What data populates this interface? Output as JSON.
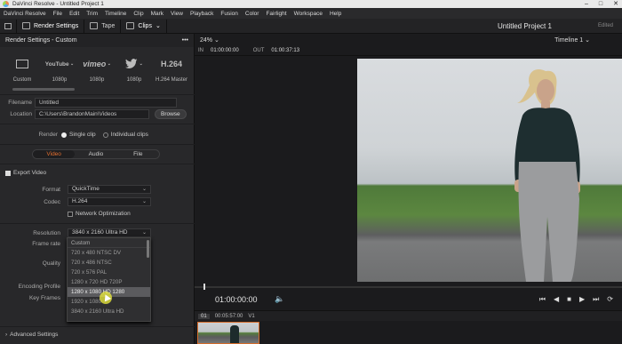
{
  "titlebar": {
    "title": "DaVinci Resolve - Untitled Project 1",
    "controls": [
      "–",
      "□",
      "✕"
    ]
  },
  "menu": [
    "DaVinci Resolve",
    "File",
    "Edit",
    "Trim",
    "Timeline",
    "Clip",
    "Mark",
    "View",
    "Playback",
    "Fusion",
    "Color",
    "Fairlight",
    "Workspace",
    "Help"
  ],
  "toolbar": {
    "render_settings": "Render Settings",
    "tape": "Tape",
    "clips": "Clips",
    "project_title": "Untitled Project 1",
    "status": "Edited"
  },
  "panel": {
    "header": "Render Settings - Custom",
    "menu_dots": "•••",
    "presets": [
      {
        "icon": "▭",
        "label": "Custom"
      },
      {
        "icon": "YouTube",
        "label": "1080p"
      },
      {
        "icon": "vimeo",
        "label": "1080p"
      },
      {
        "icon": "🐦",
        "label": "1080p"
      },
      {
        "icon": "H.264",
        "label": "H.264 Master"
      }
    ],
    "filename_label": "Filename",
    "filename_value": "Untitled",
    "location_label": "Location",
    "location_value": "C:\\Users\\BrandonMain\\Videos",
    "browse": "Browse",
    "render_label": "Render",
    "render_single": "Single clip",
    "render_individual": "Individual clips",
    "tabs": [
      "Video",
      "Audio",
      "File"
    ],
    "export_video": "Export Video",
    "format_label": "Format",
    "format_value": "QuickTime",
    "codec_label": "Codec",
    "codec_value": "H.264",
    "network_opt": "Network Optimization",
    "resolution_label": "Resolution",
    "resolution_value": "3840 x 2160 Ultra HD",
    "framerate_label": "Frame rate",
    "quality_label": "Quality",
    "encoding_label": "Encoding Profile",
    "keyframes_label": "Key Frames",
    "advanced": "Advanced Settings"
  },
  "dropdown": {
    "items": [
      "Custom",
      "720 x 480 NTSC DV",
      "720 x 486 NTSC",
      "720 x 576 PAL",
      "1280 x 720 HD 720P",
      "1280 x 1080 HD 1280",
      "1920 x 1080",
      "3840 x 2160 Ultra HD"
    ],
    "highlighted_index": 5
  },
  "viewer": {
    "zoom": "24%",
    "timeline": "Timeline 1",
    "in_label": "IN",
    "in_value": "01:00:00:00",
    "out_label": "OUT",
    "out_value": "01:00:37:13",
    "timecode": "01:00:00:00",
    "clip_num": "01",
    "clip_tc": "00:05:57:00",
    "clip_track": "V1",
    "transport": [
      "⏮",
      "◀",
      "■",
      "▶",
      "⏭",
      "⟳"
    ]
  },
  "colors": {
    "accent": "#e46f2f",
    "bg": "#1b1b1d",
    "panel": "#28282a"
  }
}
